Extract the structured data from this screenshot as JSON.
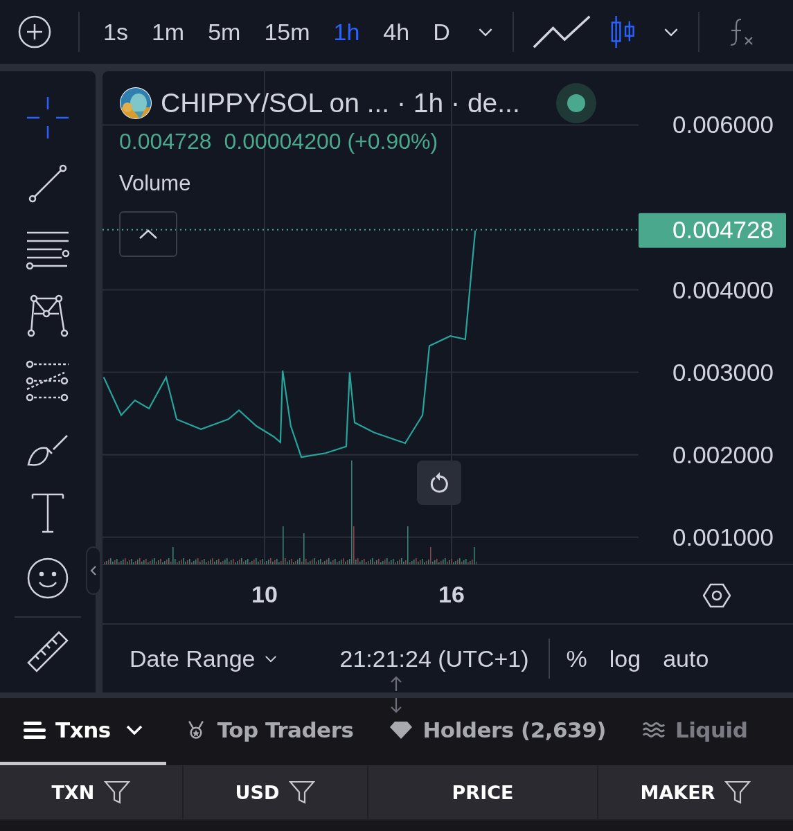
{
  "toolbar": {
    "intervals": [
      {
        "label": "1s",
        "selected": false
      },
      {
        "label": "1m",
        "selected": false
      },
      {
        "label": "5m",
        "selected": false
      },
      {
        "label": "15m",
        "selected": false
      },
      {
        "label": "1h",
        "selected": true
      },
      {
        "label": "4h",
        "selected": false
      },
      {
        "label": "D",
        "selected": false
      }
    ],
    "chart_types": [
      {
        "kind": "line",
        "selected": false
      },
      {
        "kind": "candles",
        "selected": true
      }
    ]
  },
  "drawing_tools": [
    {
      "kind": "crosshair",
      "selected": true
    },
    {
      "kind": "trend-line",
      "selected": false
    },
    {
      "kind": "horizontal-lines",
      "selected": false
    },
    {
      "kind": "pattern",
      "selected": false
    },
    {
      "kind": "fib",
      "selected": false
    },
    {
      "kind": "brush",
      "selected": false
    },
    {
      "kind": "text",
      "selected": false
    },
    {
      "kind": "emoji",
      "selected": false
    },
    {
      "kind": "ruler",
      "selected": false
    }
  ],
  "legend": {
    "title": "CHIPPY/SOL on ... · 1h · de...",
    "live": true,
    "last": "0.004728",
    "change": "0.00004200 (+0.90%)",
    "volume_label": "Volume"
  },
  "chart_data": {
    "type": "line",
    "x": [
      4.84,
      5.4,
      5.84,
      6.29,
      6.84,
      7.18,
      7.96,
      8.84,
      9.18,
      9.73,
      10.29,
      10.51,
      10.58,
      10.84,
      11.18,
      11.96,
      12.62,
      12.73,
      12.89,
      13.51,
      14.51,
      15.07,
      15.29,
      15.96,
      16.44,
      16.62,
      16.76
    ],
    "grid": true,
    "series": [
      {
        "color": "#26a69a",
        "values": [
          0.00294,
          0.00248,
          0.00266,
          0.00256,
          0.00294,
          0.00243,
          0.00231,
          0.00243,
          0.00254,
          0.00235,
          0.00222,
          0.00215,
          0.00302,
          0.00235,
          0.00197,
          0.00202,
          0.0021,
          0.003,
          0.00239,
          0.00227,
          0.00214,
          0.00248,
          0.00332,
          0.00344,
          0.0034,
          0.00415,
          0.00472
        ]
      }
    ],
    "xlim": [
      4.8,
      22
    ],
    "ylim": [
      0.00067,
      0.00665
    ],
    "xticks": [
      10,
      16
    ],
    "yticks": [
      {
        "value": 0.006,
        "label": "0.006000"
      },
      {
        "value": 0.004,
        "label": "0.004000"
      },
      {
        "value": 0.003,
        "label": "0.003000"
      },
      {
        "value": 0.002,
        "label": "0.002000"
      },
      {
        "value": 0.001,
        "label": "0.001000"
      }
    ],
    "ref_lines": [
      {
        "axis": "y",
        "value": 0.004728,
        "label": "0.004728"
      }
    ]
  },
  "bottom_bar": {
    "date_range": "Date Range",
    "clock": "21:21:24 (UTC+1)",
    "options": [
      "%",
      "log",
      "auto"
    ]
  },
  "tabs": [
    {
      "kind": "txns",
      "label": "Txns",
      "selected": true
    },
    {
      "kind": "traders",
      "label": "Top Traders",
      "selected": false
    },
    {
      "kind": "holders",
      "label": "Holders (2,639)",
      "selected": false
    },
    {
      "kind": "liquidity",
      "label": "Liquid",
      "selected": false
    }
  ],
  "table": {
    "columns": [
      {
        "label": "TXN",
        "filter": true
      },
      {
        "label": "USD",
        "filter": true
      },
      {
        "label": "PRICE",
        "filter": false
      },
      {
        "label": "MAKER",
        "filter": true
      }
    ]
  }
}
